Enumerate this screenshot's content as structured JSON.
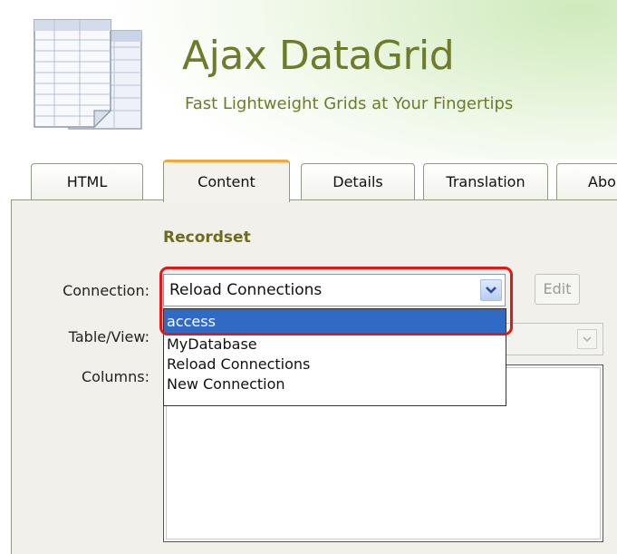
{
  "header": {
    "title": "Ajax DataGrid",
    "subtitle": "Fast Lightweight Grids at Your Fingertips",
    "icon": "spreadsheet-documents-icon"
  },
  "tabs": [
    {
      "label": "HTML",
      "active": false
    },
    {
      "label": "Content",
      "active": true
    },
    {
      "label": "Details",
      "active": false
    },
    {
      "label": "Translation",
      "active": false
    },
    {
      "label": "Abo",
      "active": false
    }
  ],
  "recordset": {
    "section_title": "Recordset",
    "connection_label": "Connection:",
    "connection_value": "Reload Connections",
    "edit_label": "Edit",
    "table_view_label": "Table/View:",
    "columns_label": "Columns:",
    "dropdown_options": [
      "access",
      "MyDatabase",
      "Reload Connections",
      "New Connection"
    ],
    "highlighted_option": "access"
  },
  "colors": {
    "brand": "#6d7b2b",
    "selection": "#316ac5",
    "highlight_border": "#e01818",
    "active_tab_accent": "#f0a93a"
  }
}
